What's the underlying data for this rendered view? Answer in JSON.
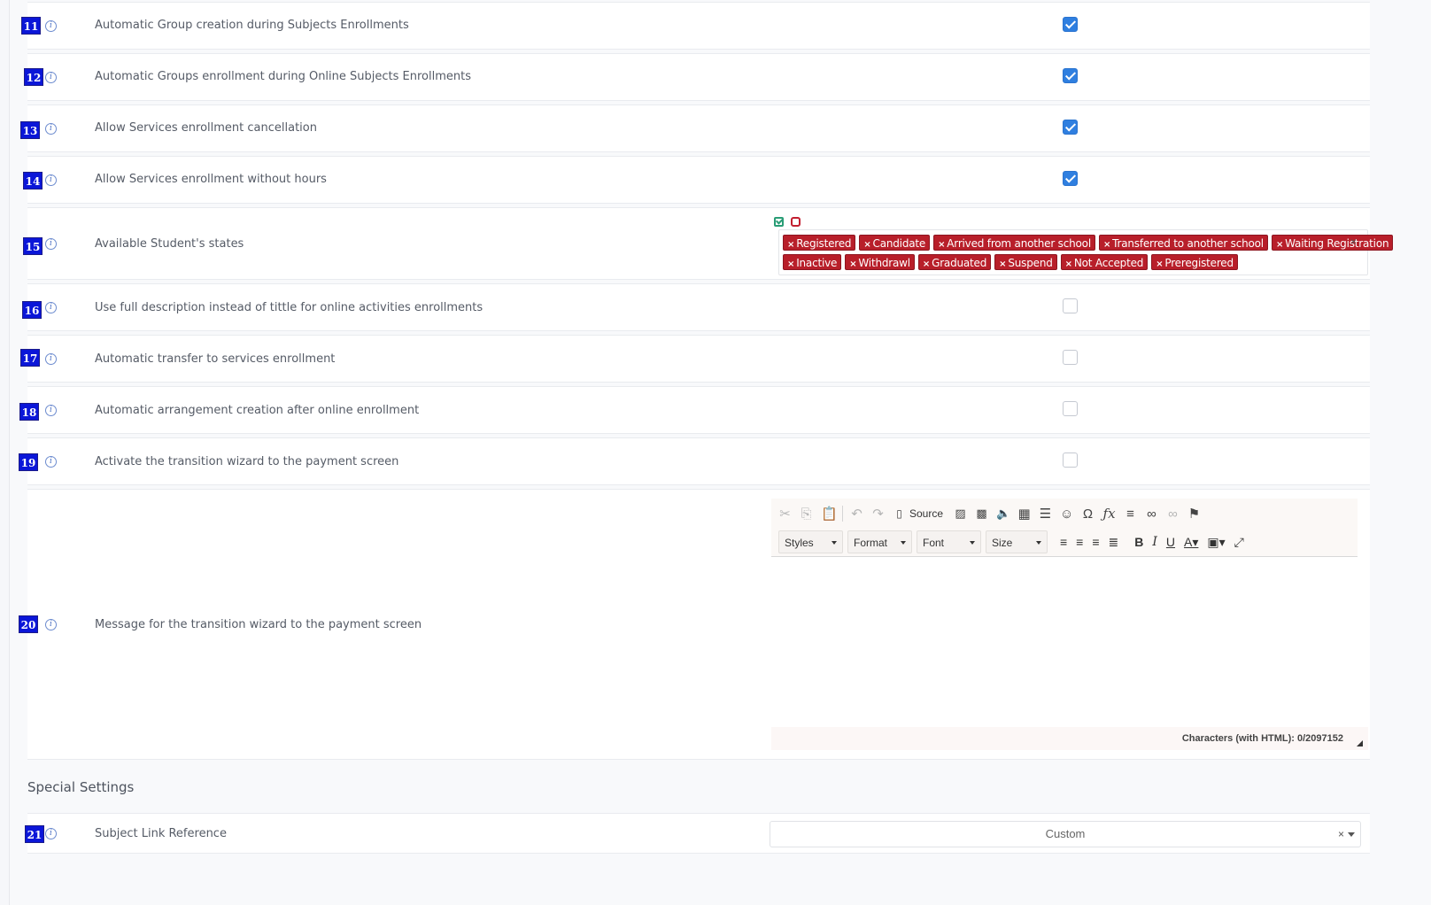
{
  "settings": [
    {
      "num": "11",
      "label": "Automatic Group creation during Subjects Enrollments",
      "checked": true
    },
    {
      "num": "12",
      "label": "Automatic Groups enrollment during Online Subjects Enrollments",
      "checked": true
    },
    {
      "num": "13",
      "label": "Allow Services enrollment cancellation",
      "checked": true
    },
    {
      "num": "14",
      "label": "Allow Services enrollment without hours",
      "checked": true
    },
    {
      "num": "15",
      "label": "Available Student's states"
    },
    {
      "num": "16",
      "label": "Use full description instead of tittle for online activities enrollments",
      "checked": false
    },
    {
      "num": "17",
      "label": "Automatic transfer to services enrollment",
      "checked": false
    },
    {
      "num": "18",
      "label": "Automatic arrangement creation after online enrollment",
      "checked": false
    },
    {
      "num": "19",
      "label": "Activate the transition wizard to the payment screen",
      "checked": false
    },
    {
      "num": "20",
      "label": "Message for the transition wizard to the payment screen"
    },
    {
      "num": "21",
      "label": "Subject Link Reference"
    }
  ],
  "info_glyph": "i",
  "tags": {
    "row1": [
      "Registered",
      "Candidate",
      "Arrived from another school",
      "Transferred to another school",
      "Waiting Registration"
    ],
    "row2": [
      "Inactive",
      "Withdrawl",
      "Graduated",
      "Suspend",
      "Not Accepted",
      "Preregistered"
    ],
    "remove_glyph": "×",
    "clear_all_glyph": "×",
    "tag_color": "#b81f2a"
  },
  "editor": {
    "source_label": "Source",
    "styles_label": "Styles",
    "format_label": "Format",
    "font_label": "Font",
    "size_label": "Size",
    "char_count": "Characters (with HTML): 0/2097152",
    "icons": [
      "cut-icon",
      "copy-icon",
      "paste-icon",
      "undo-icon",
      "redo-icon",
      "source-icon",
      "image-icon",
      "image2-icon",
      "audio-icon",
      "table-icon",
      "horizontal-line-icon",
      "smiley-icon",
      "special-char-icon",
      "formula-icon",
      "list-icon",
      "link-icon",
      "unlink-icon",
      "anchor-icon",
      "align-left-icon",
      "align-center-icon",
      "align-right-icon",
      "justify-icon",
      "bold-icon",
      "italic-icon",
      "underline-icon",
      "text-color-icon",
      "bg-color-icon",
      "maximize-icon"
    ]
  },
  "special": {
    "title": "Special Settings",
    "select_value": "Custom",
    "clear_glyph": "×"
  },
  "colors": {
    "badge": "#0b16d8",
    "checkbox": "#2f7fe0"
  }
}
